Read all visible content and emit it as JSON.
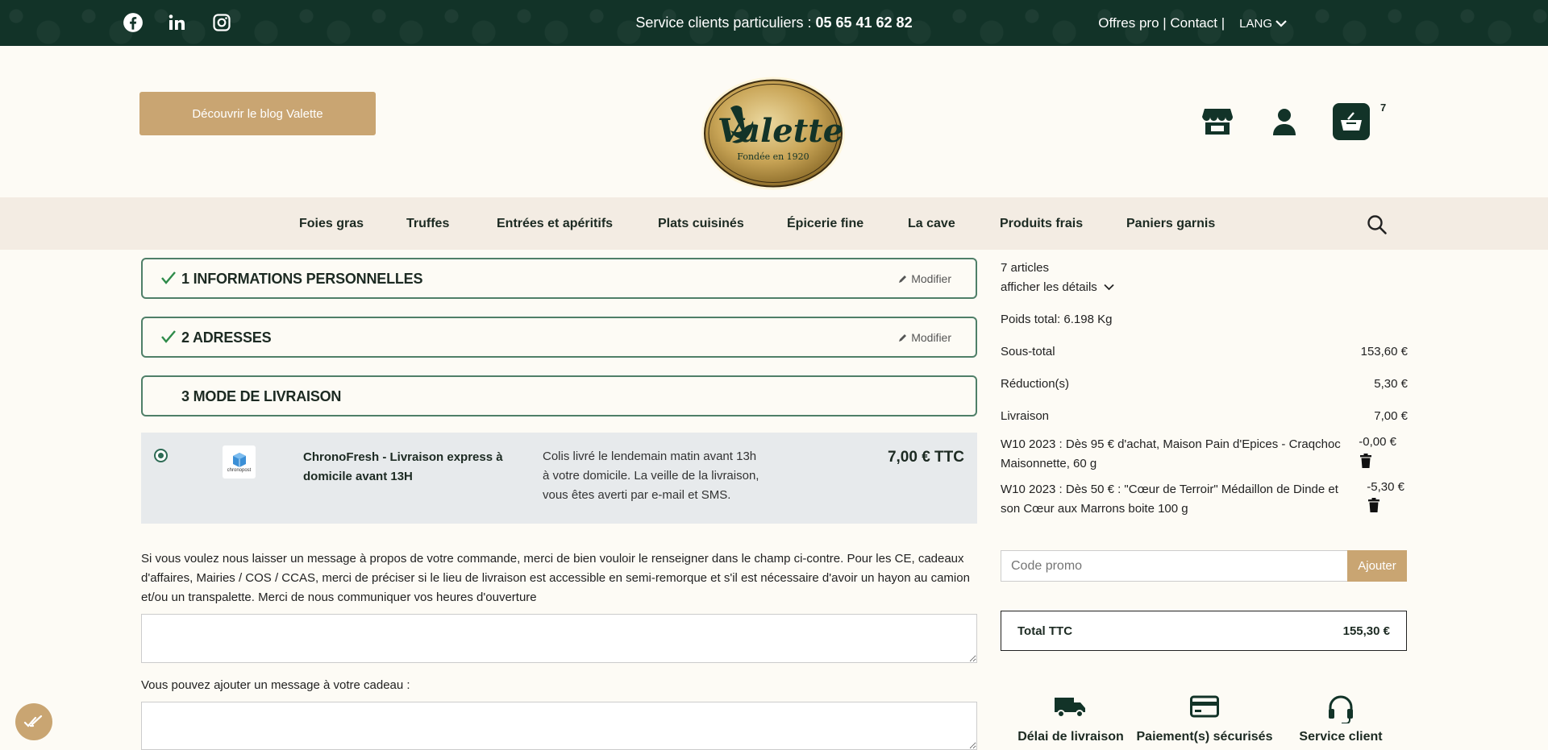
{
  "topbar": {
    "phone_label": "Service clients particuliers : ",
    "phone_number": "05 65 41 62 82",
    "links": "Offres pro | Contact |",
    "lang": "LANG"
  },
  "header": {
    "blog_button": "Découvrir le blog Valette",
    "logo_text": "Valette",
    "logo_sub": "Fondée en 1920",
    "cart_count": "7"
  },
  "nav": {
    "items": [
      "Foies gras",
      "Truffes",
      "Entrées et apéritifs",
      "Plats cuisinés",
      "Épicerie fine",
      "La cave",
      "Produits frais",
      "Paniers garnis"
    ]
  },
  "steps": [
    {
      "title": "1 INFORMATIONS PERSONNELLES",
      "action": "Modifier"
    },
    {
      "title": "2 ADRESSES",
      "action": "Modifier"
    },
    {
      "title": "3 MODE DE LIVRAISON"
    }
  ],
  "delivery": {
    "carrier_logo": "chronopost",
    "name": "ChronoFresh - Livraison express à domicile avant 13H",
    "description_lines": [
      "Colis livré le lendemain matin avant 13h",
      "à votre domicile. La veille de la livraison,",
      "vous êtes averti par e-mail et SMS."
    ],
    "price": "7,00 € TTC"
  },
  "message": {
    "instructions": "Si vous voulez nous laisser un message à propos de votre commande, merci de bien vouloir le renseigner dans le champ ci-contre. Pour les CE, cadeaux d'affaires, Mairies / COS / CCAS, merci de préciser si le lieu de livraison est accessible en semi-remorque et s'il est nécessaire d'avoir un hayon au camion et/ou un transpalette. Merci de nous communiquer vos heures d'ouverture",
    "gift_label": "Vous pouvez ajouter un message à votre cadeau :"
  },
  "summary": {
    "articles": "7 articles",
    "details": "afficher les détails",
    "weight": "Poids total: 6.198 Kg",
    "subtotal_label": "Sous-total",
    "subtotal": "153,60 €",
    "discount_label": "Réduction(s)",
    "discount": "5,30 €",
    "shipping_label": "Livraison",
    "shipping": "7,00 €",
    "vouchers": [
      {
        "line1": "W10 2023 : Dès 95 € d'achat, Maison Pain d'Epices - Craqchoc",
        "line2": "Maisonnette, 60 g",
        "amount": "-0,00 €"
      },
      {
        "line1": "W10 2023 : Dès 50 € : \"Cœur de Terroir\" Médaillon de Dinde et",
        "line2": "son Cœur aux Marrons boite 100 g",
        "amount": "-5,30 €"
      }
    ],
    "promo_placeholder": "Code promo",
    "promo_button": "Ajouter",
    "total_label": "Total TTC",
    "total": "155,30 €"
  },
  "reassurance": [
    "Délai de livraison",
    "Paiement(s) sécurisés",
    "Service client"
  ],
  "colors": {
    "dark_green": "#123328",
    "gold": "#c9a572",
    "nav_bg": "#f3ece3"
  }
}
